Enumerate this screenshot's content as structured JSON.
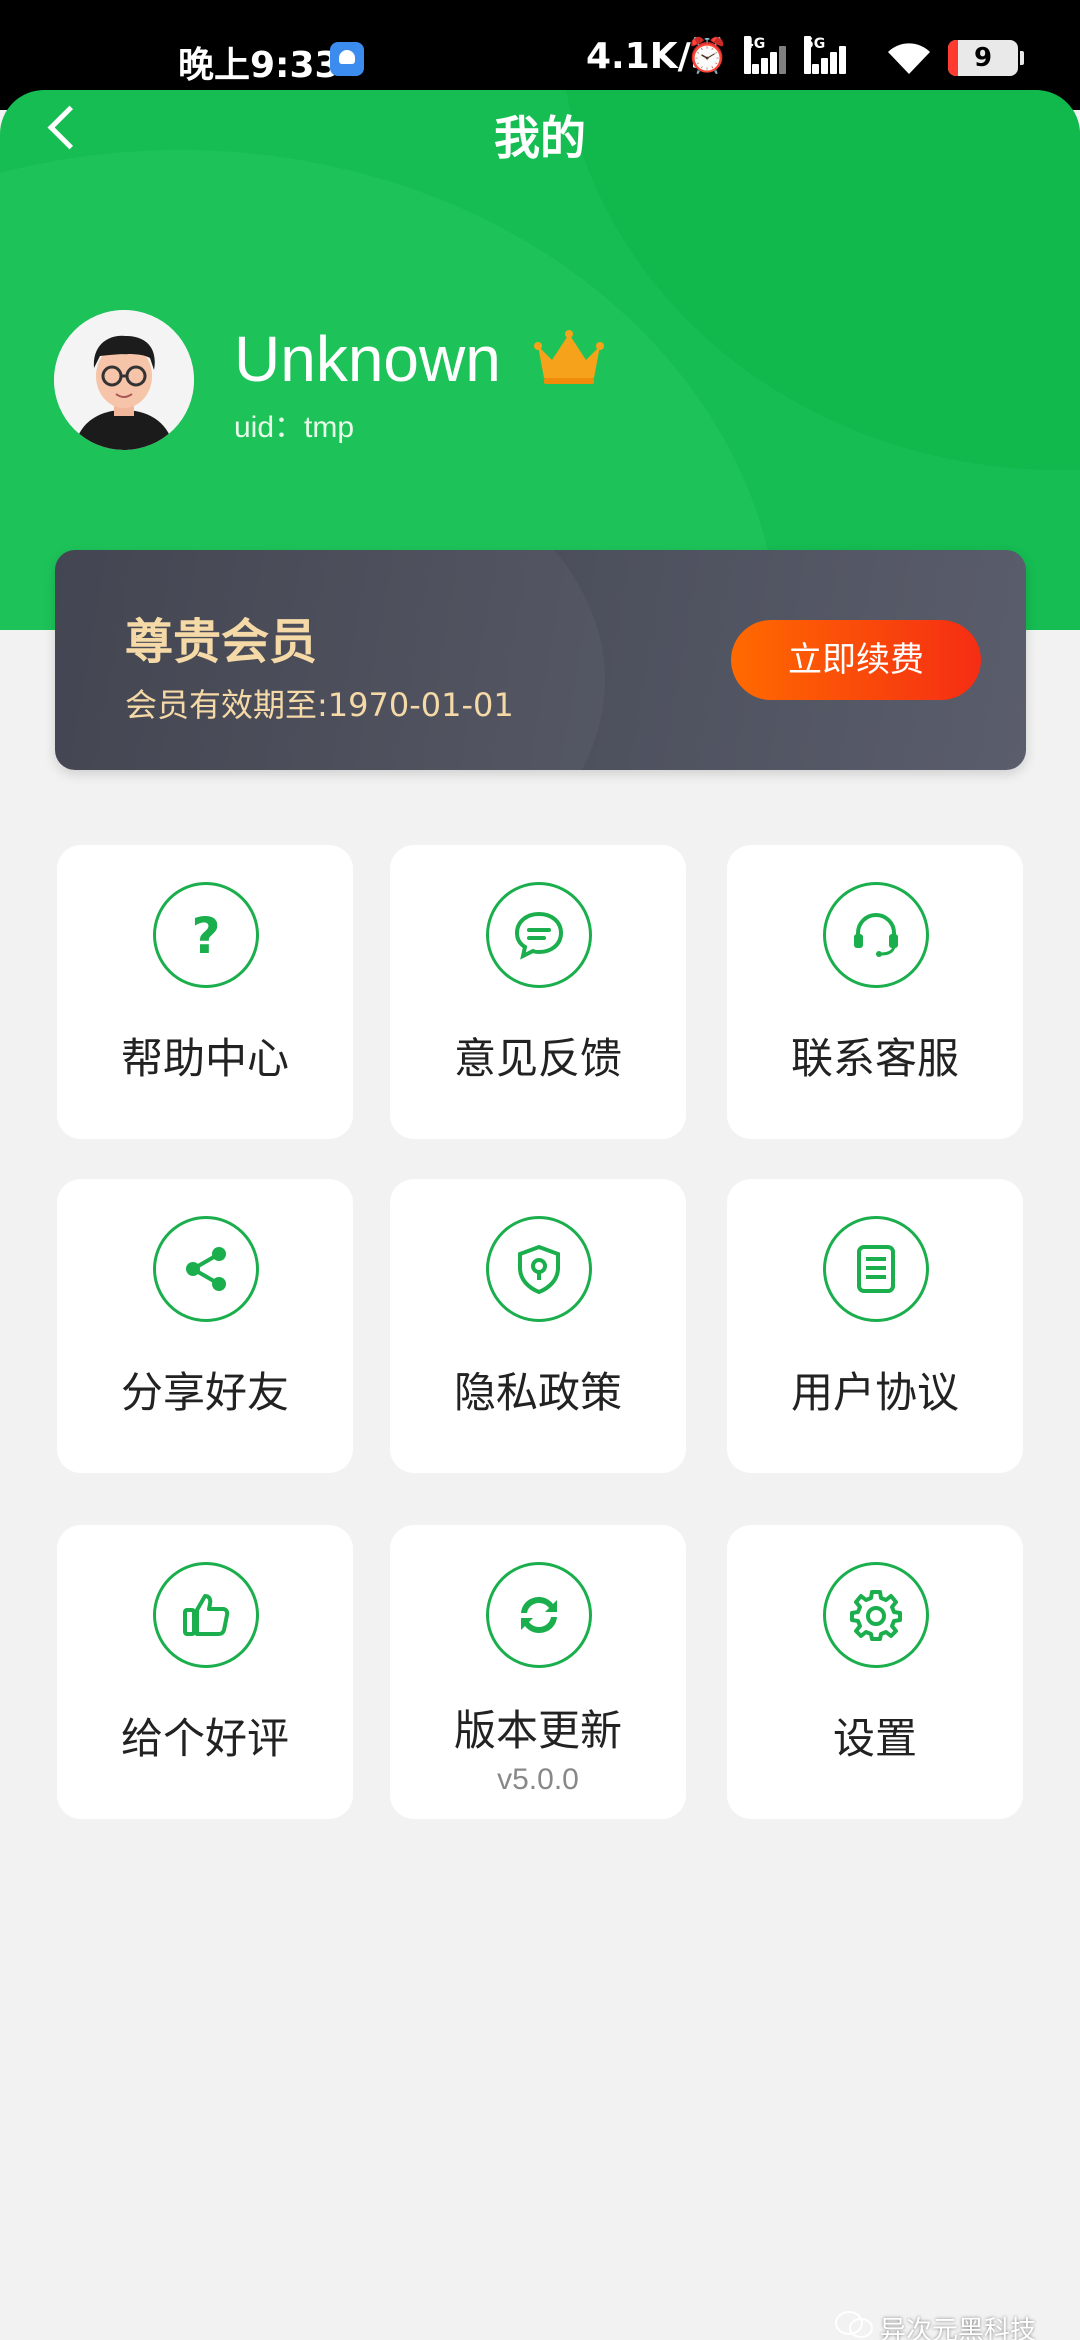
{
  "status_bar": {
    "time": "晚上9:33",
    "speed": "4.1K/s",
    "net1": "4G",
    "net2": "5G",
    "battery": "9"
  },
  "header": {
    "title": "我的"
  },
  "profile": {
    "name": "Unknown",
    "uid": "uid：tmp"
  },
  "vip": {
    "title": "尊贵会员",
    "expiry": "会员有效期至:1970-01-01",
    "renew_label": "立即续费"
  },
  "menu": [
    {
      "label": "帮助中心",
      "icon": "help-icon"
    },
    {
      "label": "意见反馈",
      "icon": "feedback-icon"
    },
    {
      "label": "联系客服",
      "icon": "headset-icon"
    },
    {
      "label": "分享好友",
      "icon": "share-icon"
    },
    {
      "label": "隐私政策",
      "icon": "shield-icon"
    },
    {
      "label": "用户协议",
      "icon": "document-icon"
    },
    {
      "label": "给个好评",
      "icon": "thumbs-up-icon"
    },
    {
      "label": "版本更新",
      "icon": "refresh-icon",
      "sub": "v5.0.0"
    },
    {
      "label": "设置",
      "icon": "gear-icon"
    }
  ],
  "watermark": "异次元黑科技",
  "colors": {
    "primary_green": "#15bd52",
    "vip_gold": "#f5d9a6",
    "renew_orange": "#ff6a00"
  }
}
